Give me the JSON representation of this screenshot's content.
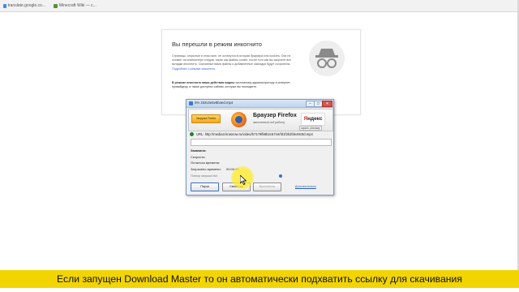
{
  "browser": {
    "tabs": [
      {
        "label": "translate.google.co..."
      },
      {
        "label": "Minecraft Wiki — с..."
      }
    ]
  },
  "incognito": {
    "title": "Вы перешли в режим инкогнито",
    "body": "Страницы, открытые в этом окне, не останутся в истории браузера или cookies. Они не оставят на компьютере следов, такие как файлы cookie, после того как вы закроете все вкладки инкогнито. Скачанные вами файлы и добавленные закладки будут сохранены.",
    "body_link": "Подробнее о режиме инкогнито.",
    "warning_bold": "В режиме инкогнито ваши действия видны",
    "warning_rest": "системному администратору и интернет-провайдеру, а также доступны сайтам, которые вы посещаете."
  },
  "dialog": {
    "title": "0% z82v2e5v8b4ed.mp4",
    "banner_button": "Загрузка Firefox",
    "banner_heading": "Браузер Firefox",
    "banner_sub": "заточенный под работу",
    "yandex_first": "Я",
    "yandex_rest": "ндекс",
    "hide_label": "скрыть рекламу",
    "url_label": "URL:",
    "url_value": "http://media3.krasnow.ru/video/b7179fb9b2c5744rfd1f2k2fde48c9d.mp4",
    "status_label": "Закачано:",
    "speed_label": "Скорость:",
    "remaining_label": "Осталось времени:",
    "elapsed_label": "Затрачено времени:",
    "elapsed_value": "00:00:00",
    "retry_label": "Повтор запроса №0",
    "progress_fraction": 0.0,
    "more_label": "Дополнительно",
    "buttons": {
      "pause": "Пауза",
      "properties": "Свойства",
      "open": "Выполнить"
    }
  },
  "subtitle": "Если запущен Download Master то он автоматически подхватить ссылку для скачивания"
}
